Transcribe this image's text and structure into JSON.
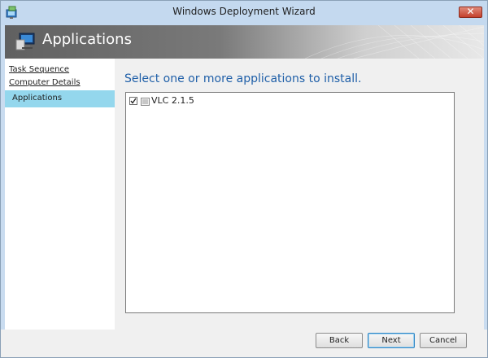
{
  "window": {
    "title": "Windows Deployment Wizard",
    "close_glyph": "✕"
  },
  "banner": {
    "title": "Applications",
    "icon": "computer-icon"
  },
  "sidebar": {
    "items": [
      {
        "label": "Task Sequence",
        "selected": false
      },
      {
        "label": "Computer Details",
        "selected": false
      },
      {
        "label": "Applications",
        "selected": true
      }
    ]
  },
  "main": {
    "heading": "Select one or more applications to install.",
    "applications": [
      {
        "label": "VLC 2.1.5",
        "checked": true
      }
    ]
  },
  "footer": {
    "back_label": "Back",
    "next_label": "Next",
    "cancel_label": "Cancel"
  },
  "colors": {
    "heading": "#1f5fa8",
    "selected_nav": "#94d7ed",
    "titlebar": "#c4d9ef",
    "close_button": "#c4402c"
  }
}
